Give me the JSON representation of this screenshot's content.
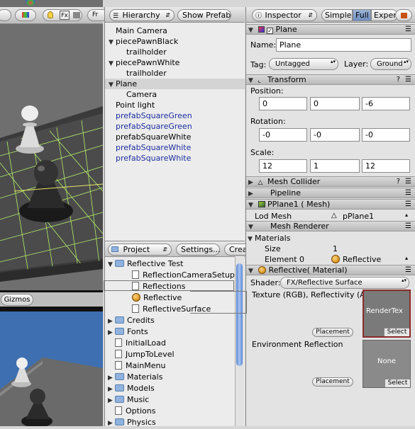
{
  "scene": {
    "toolbar": {
      "fx_label": "Fx",
      "cut_label": "Fr"
    },
    "gizmos_label": "Gizmos"
  },
  "hierarchy": {
    "title": "Hierarchy",
    "show_prefab": "Show Prefab",
    "items": [
      {
        "label": "Main Camera",
        "indent": 0,
        "arrow": false,
        "style": "normal"
      },
      {
        "label": "piecePawnBlack",
        "indent": 0,
        "arrow": true,
        "style": "normal"
      },
      {
        "label": "trailholder",
        "indent": 1,
        "arrow": false,
        "style": "normal"
      },
      {
        "label": "piecePawnWhite",
        "indent": 0,
        "arrow": true,
        "style": "normal"
      },
      {
        "label": "trailholder",
        "indent": 1,
        "arrow": false,
        "style": "normal"
      },
      {
        "label": "Plane",
        "indent": 0,
        "arrow": true,
        "style": "selected"
      },
      {
        "label": "Camera",
        "indent": 1,
        "arrow": false,
        "style": "normal"
      },
      {
        "label": "Point light",
        "indent": 0,
        "arrow": false,
        "style": "normal"
      },
      {
        "label": "prefabSquareGreen",
        "indent": 0,
        "arrow": false,
        "style": "blue"
      },
      {
        "label": "prefabSquareGreen",
        "indent": 0,
        "arrow": false,
        "style": "blue"
      },
      {
        "label": "prefabSquareWhite",
        "indent": 0,
        "arrow": false,
        "style": "normal"
      },
      {
        "label": "prefabSquareWhite",
        "indent": 0,
        "arrow": false,
        "style": "blue"
      },
      {
        "label": "prefabSquareWhite",
        "indent": 0,
        "arrow": false,
        "style": "blue"
      }
    ]
  },
  "project": {
    "title": "Project",
    "settings": "Settings...",
    "create": "Crea",
    "items": [
      {
        "label": "Reflective Test",
        "indent": 0,
        "icon": "folder",
        "open": true
      },
      {
        "label": "ReflectionCameraSetup",
        "indent": 1,
        "icon": "file",
        "open": false
      },
      {
        "label": "Reflections",
        "indent": 1,
        "icon": "file",
        "open": false
      },
      {
        "label": "Reflective",
        "indent": 1,
        "icon": "ball",
        "open": false
      },
      {
        "label": "ReflectiveSurface",
        "indent": 1,
        "icon": "file",
        "open": false
      },
      {
        "label": "Credits",
        "indent": 0,
        "icon": "folder",
        "open": false
      },
      {
        "label": "Fonts",
        "indent": 0,
        "icon": "folder",
        "open": false
      },
      {
        "label": "InitialLoad",
        "indent": 0,
        "icon": "file",
        "open": false
      },
      {
        "label": "JumpToLevel",
        "indent": 0,
        "icon": "file",
        "open": false
      },
      {
        "label": "MainMenu",
        "indent": 0,
        "icon": "file",
        "open": false
      },
      {
        "label": "Materials",
        "indent": 0,
        "icon": "folder",
        "open": false
      },
      {
        "label": "Models",
        "indent": 0,
        "icon": "folder",
        "open": false
      },
      {
        "label": "Music",
        "indent": 0,
        "icon": "folder",
        "open": false
      },
      {
        "label": "Options",
        "indent": 0,
        "icon": "file",
        "open": false
      },
      {
        "label": "Physics",
        "indent": 0,
        "icon": "folder",
        "open": false
      }
    ]
  },
  "inspector": {
    "title": "Inspector",
    "simple": "Simple",
    "full": "Full",
    "expert": "Exper",
    "object_name_header": "Plane",
    "name_label": "Name:",
    "name_value": "Plane",
    "tag_label": "Tag:",
    "tag_value": "Untagged",
    "layer_label": "Layer:",
    "layer_value": "Ground",
    "transform": {
      "title": "Transform",
      "position_label": "Position:",
      "position": [
        "0",
        "0",
        "-6"
      ],
      "rotation_label": "Rotation:",
      "rotation": [
        "-0",
        "-0",
        "-0"
      ],
      "scale_label": "Scale:",
      "scale": [
        "12",
        "1",
        "12"
      ]
    },
    "mesh_collider": "Mesh Collider",
    "pipeline": "Pipeline",
    "pplane": "PPlane1 ( Mesh)",
    "lod_label": "Lod Mesh",
    "lod_value": "pPlane1",
    "mesh_renderer": "Mesh Renderer",
    "materials_label": "Materials",
    "size_label": "Size",
    "size_value": "1",
    "element_label": "Element 0",
    "element_value": "Reflective",
    "material_header": "Reflective( Material)",
    "shader_label": "Shader:",
    "shader_value": "FX/Reflective Surface",
    "texture_label": "Texture (RGB), Reflectivity (A",
    "render_tex": "RenderTex",
    "select": "Select",
    "placement": "Placement",
    "env_label": "Environment Reflection",
    "none": "None",
    "question": "?",
    "menu_glyph": "☰"
  }
}
